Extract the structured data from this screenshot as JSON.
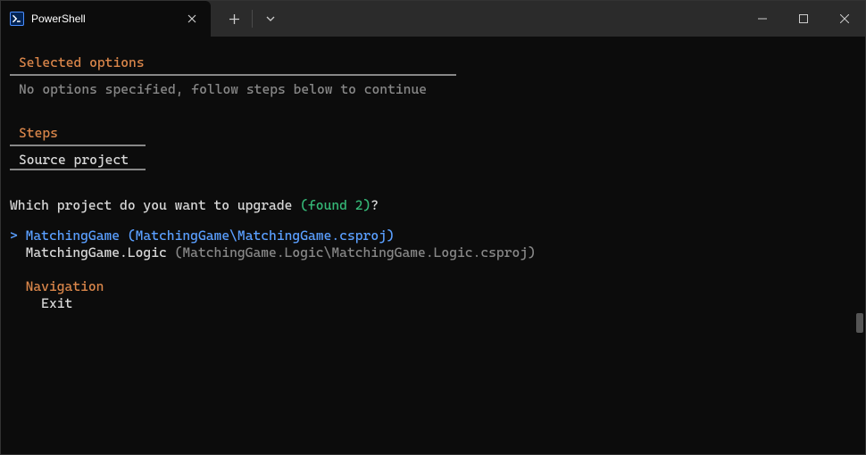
{
  "window": {
    "tab_title": "PowerShell"
  },
  "sections": {
    "selected_options_header": "Selected options",
    "selected_options_body": "No options specified, follow steps below to continue",
    "steps_header": "Steps",
    "steps_item": "Source project"
  },
  "prompt": {
    "question_prefix": "Which project do you want to upgrade ",
    "found_text": "(found 2)",
    "question_suffix": "?"
  },
  "options": {
    "caret": ">",
    "selected_name": "MatchingGame",
    "selected_path": " (MatchingGame\\MatchingGame.csproj)",
    "unselected_name": "MatchingGame.Logic ",
    "unselected_path": "(MatchingGame.Logic\\MatchingGame.Logic.csproj)"
  },
  "nav": {
    "header": "Navigation",
    "exit": "Exit"
  }
}
